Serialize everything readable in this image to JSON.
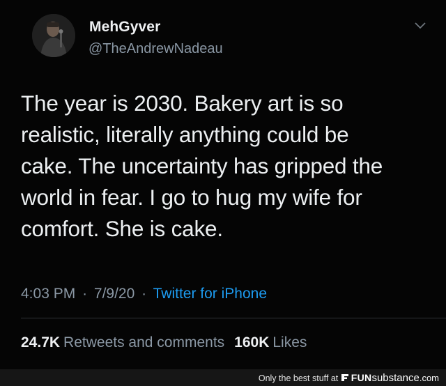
{
  "tweet": {
    "display_name": "MehGyver",
    "handle": "@TheAndrewNadeau",
    "text_lines": [
      "The year is 2030. Bakery art is so",
      "realistic, literally anything could be",
      "cake. The uncertainty has gripped the",
      "world in fear. I go to hug my wife for",
      "comfort. She is cake."
    ],
    "time": "4:03 PM",
    "separator": "·",
    "date": "7/9/20",
    "client": "Twitter for iPhone",
    "retweets_count": "24.7K",
    "retweets_label": "Retweets and comments",
    "likes_count": "160K",
    "likes_label": "Likes"
  },
  "footer": {
    "tagline": "Only the best stuff at",
    "brand_bold": "FUN",
    "brand_regular": "substance",
    "brand_suffix": ".com"
  },
  "colors": {
    "background": "#000000",
    "text": "#eceff1",
    "muted": "#8b98a5",
    "link": "#1d9bf0"
  },
  "icons": {
    "more_options": "chevron-down-icon",
    "brand": "funsubstance-logo-icon"
  }
}
